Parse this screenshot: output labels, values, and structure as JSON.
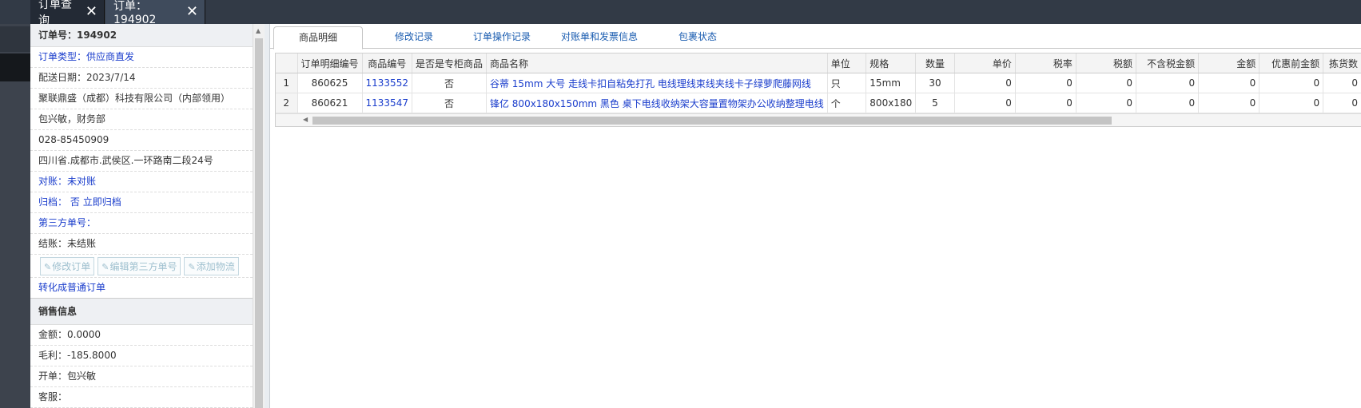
{
  "top_tabs": [
    {
      "label": "订单查询",
      "close": "✕"
    },
    {
      "label": "订单：194902",
      "close": "✕"
    }
  ],
  "order_panel": {
    "order_no": "订单号：194902",
    "order_type": "订单类型：供应商直发",
    "delivery_date": "配送日期：2023/7/14",
    "company": "聚联鼎盛（成都）科技有限公司（内部领用）",
    "contact": "包兴敏，财务部",
    "phone": "028-85450909",
    "address": "四川省.成都市.武侯区.一环路南二段24号",
    "reconcile": "对账：未对账",
    "archive_label": "归档：",
    "archive_value": "否",
    "archive_link": "立即归档",
    "third_party_no": "第三方单号：",
    "settlement": "结账：未结账",
    "buttons": {
      "modify_order": "修改订单",
      "edit_third_party": "编辑第三方单号",
      "add_logistics": "添加物流"
    },
    "convert_link": "转化成普通订单"
  },
  "sales_info": {
    "title": "销售信息",
    "amount": "金额：0.0000",
    "gross_profit": "毛利：-185.8000",
    "issuer": "开单：包兴敏",
    "customer_service": "客服："
  },
  "content_tabs": [
    "商品明细",
    "修改记录",
    "订单操作记录",
    "对账单和发票信息",
    "包裹状态"
  ],
  "table": {
    "columns": [
      "",
      "订单明细编号",
      "商品编号",
      "是否是专柜商品",
      "商品名称",
      "单位",
      "规格",
      "数量",
      "单价",
      "税率",
      "税额",
      "不含税金额",
      "金额",
      "优惠前金额",
      "拣货数"
    ],
    "rows": [
      [
        "1",
        "860625",
        "1133552",
        "否",
        "谷蒂 15mm 大号 走线卡扣自粘免打孔 电线理线束线夹线卡子绿萝爬藤网线",
        "只",
        "15mm",
        "30",
        "0",
        "0",
        "0",
        "0",
        "0",
        "0",
        "0"
      ],
      [
        "2",
        "860621",
        "1133547",
        "否",
        "锋亿 800x180x150mm 黑色 桌下电线收纳架大容量置物架办公收纳整理电线",
        "个",
        "800x180",
        "5",
        "0",
        "0",
        "0",
        "0",
        "0",
        "0",
        "0"
      ]
    ]
  }
}
